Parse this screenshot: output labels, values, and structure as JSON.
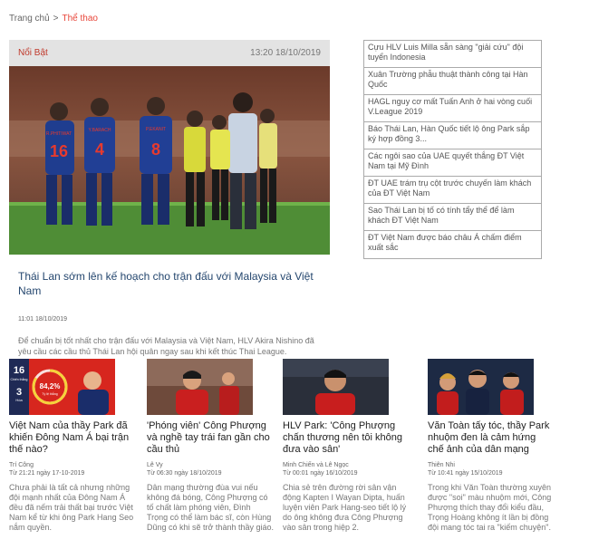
{
  "breadcrumb": {
    "home": "Trang chủ",
    "separator": ">",
    "current": "Thể thao"
  },
  "featured": {
    "tag": "Nổi Bật",
    "time": "13:20 18/10/2019",
    "title": "Thái Lan sớm lên kế hoạch cho trận đấu với Malaysia và Việt Nam",
    "date": "11:01 18/10/2019",
    "desc": "Để chuẩn bị tốt nhất cho trận đấu với Malaysia và Việt Nam, HLV Akira Nishino đã yêu cầu các cầu thủ Thái Lan hội quân ngay sau khi kết thúc Thai League.",
    "jerseys": [
      "16",
      "4",
      "8"
    ],
    "jersey_names": [
      "R.PHITIWAT",
      "Y.BARACH",
      "P.EKANIT"
    ]
  },
  "sidebar": {
    "items": [
      "Cựu HLV Luis Milla sẵn sàng \"giải cứu\" đội tuyển Indonesia",
      "Xuân Trường phẫu thuật thành công tại Hàn Quốc",
      "HAGL nguy cơ mất Tuấn Anh ở hai vòng cuối V.League 2019",
      "Báo Thái Lan, Hàn Quốc tiết lộ ông Park sắp ký hợp đồng 3...",
      "Các ngôi sao của UAE quyết thắng ĐT Việt Nam tại Mỹ Đình",
      "ĐT UAE trám trụ cột trước chuyến làm khách của ĐT Việt Nam",
      "Sao Thái Lan bị tố có tính tẩy thể để làm khách ĐT Việt Nam",
      "ĐT Việt Nam được báo châu Á chấm điểm xuất sắc"
    ]
  },
  "cards": [
    {
      "title": "Việt Nam của thầy Park đã khiến Đông Nam Á bại trận thế nào?",
      "author": "Trí Công",
      "date": "Từ 21:21 ngày 17-10-2019",
      "desc": "Chưa phải là tất cả nhưng những đội mạnh nhất của Đông Nam Á đều đã nếm trải thất bại trước Việt Nam kể từ khi ông Park Hang Seo nắm quyền.",
      "graphic": {
        "top": "16",
        "mid": "Chiến thắng",
        "bottom": "3",
        "label": "Hòa",
        "percent": "84,2%",
        "sub": "Tỷ lệ thắng"
      }
    },
    {
      "title": "'Phóng viên' Công Phượng và nghề tay trái fan gần cho cầu thủ",
      "author": "Lê Vy",
      "date": "Từ 06:30 ngày 18/10/2019",
      "desc": "Dân mạng thường đùa vui nếu không đá bóng, Công Phượng có tố chất làm phóng viên, Đình Trọng có thể làm bác sĩ, còn Hùng Dũng có khi sẽ trở thành thầy giáo."
    },
    {
      "title": "HLV Park: 'Công Phượng chấn thương nên tôi không đưa vào sân'",
      "author": "Minh Chiến và Lê Ngọc",
      "date": "Từ 00:01 ngày 16/10/2019",
      "desc": "Chia sẻ trên đường rời sân vận động Kapten I Wayan Dipta, huấn luyện viên Park Hang-seo tiết lộ lý do ông không đưa Công Phượng vào sân trong hiệp 2."
    },
    {
      "title": "Văn Toàn tấy tóc, thầy Park nhuộm đen là cảm hứng chế ảnh của dân mạng",
      "author": "Thiên Nhi",
      "date": "Từ 10:41 ngày 15/10/2019",
      "desc": "Trong khi Văn Toàn thường xuyên được \"soi\" màu nhuộm mới, Công Phượng thích thay đổi kiểu đầu, Trọng Hoàng không ít lần bị đồng đội mang tóc tai ra \"kiếm chuyện\"."
    }
  ]
}
